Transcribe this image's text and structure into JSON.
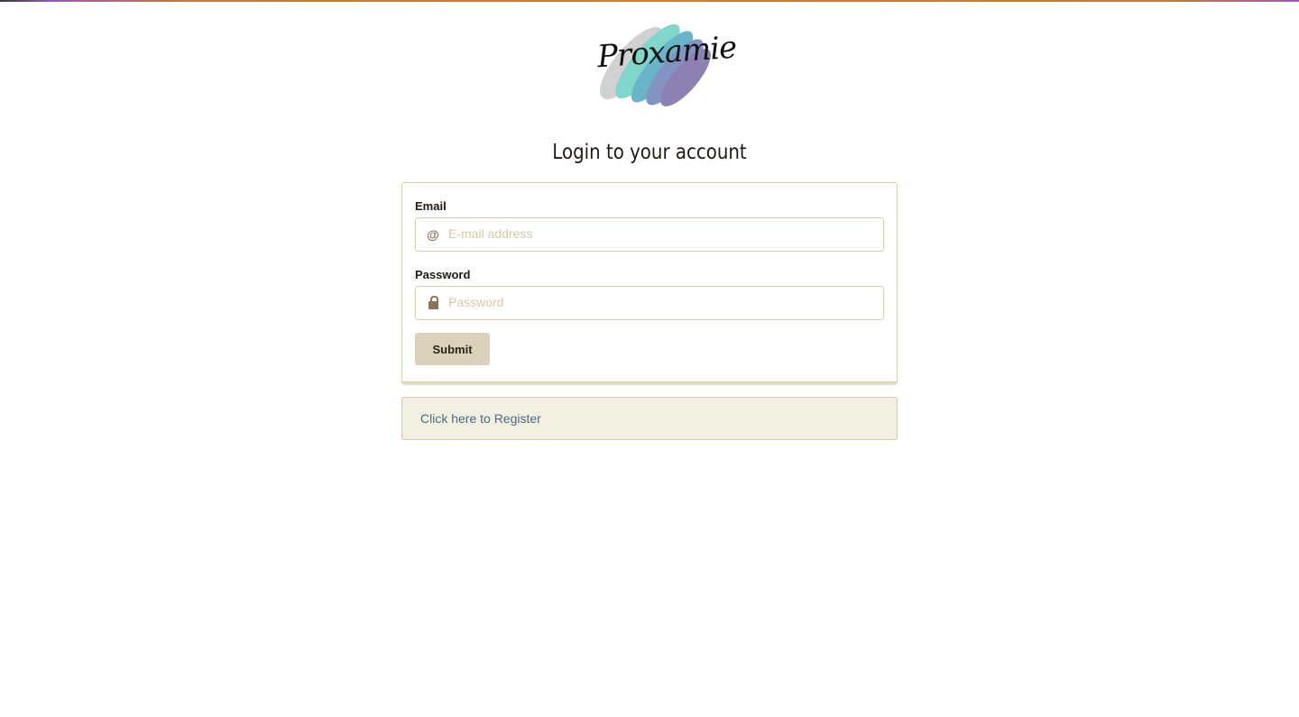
{
  "brand": {
    "name": "Proxamie"
  },
  "login": {
    "title": "Login to your account",
    "email_label": "Email",
    "email_placeholder": "E-mail address",
    "email_value": "",
    "password_label": "Password",
    "password_placeholder": "Password",
    "password_value": "",
    "submit_label": "Submit"
  },
  "register": {
    "link_label": "Click here to Register"
  },
  "icons": {
    "email": "at-sign-icon",
    "password": "lock-icon"
  },
  "colors": {
    "border": "#d9ccaa",
    "button_bg": "#dcd1ba",
    "register_bg": "#f3efe1",
    "link": "#4a6a86",
    "placeholder": "#d8c9a6"
  }
}
